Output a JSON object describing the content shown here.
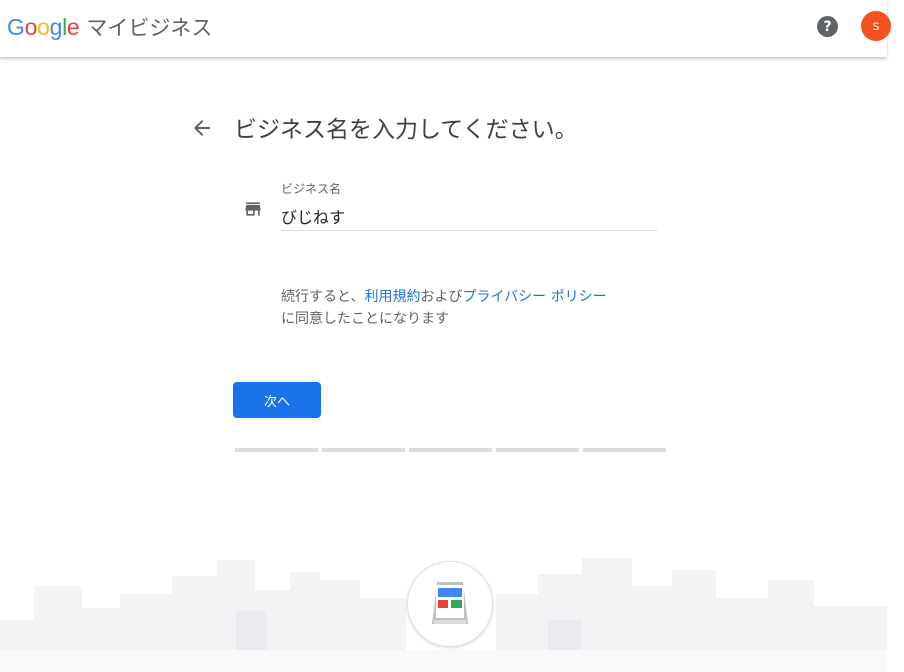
{
  "header": {
    "logo_letters": [
      "G",
      "o",
      "o",
      "g",
      "l",
      "e"
    ],
    "logo_colors": [
      "#4285F4",
      "#EA4335",
      "#FBBC05",
      "#4285F4",
      "#34A853",
      "#EA4335"
    ],
    "product_name": "マイビジネス",
    "help_icon": "help-icon",
    "avatar_letter": "s",
    "avatar_color": "#f4511e"
  },
  "main": {
    "heading": "ビジネス名を入力してください。",
    "back_icon": "arrow-back-icon",
    "field": {
      "icon": "store-icon",
      "label": "ビジネス名",
      "value": "びじねす"
    },
    "terms": {
      "prefix": "続行すると、",
      "terms_link": "利用規約",
      "middle": "および",
      "privacy_link": "プライバシー ポリシー",
      "suffix": "に同意したことになります"
    },
    "next_label": "次へ",
    "accent_color": "#1a73e8",
    "progress_steps": 5
  }
}
